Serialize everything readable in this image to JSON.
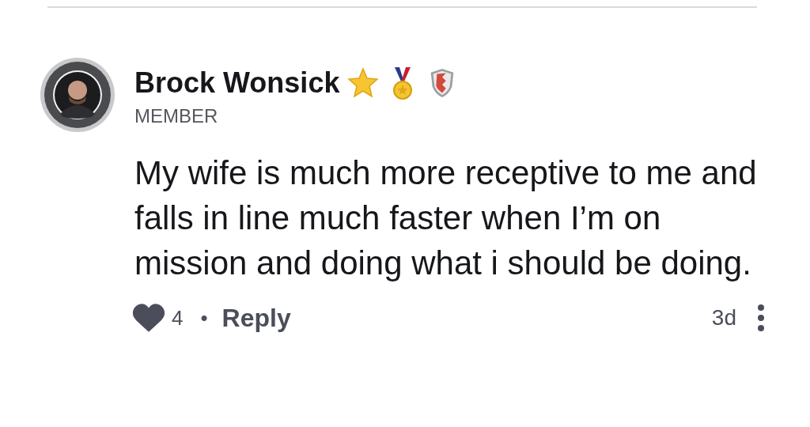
{
  "comment": {
    "author": "Brock Wonsick",
    "badges": [
      {
        "kind": "star"
      },
      {
        "kind": "medal"
      },
      {
        "kind": "shield"
      }
    ],
    "role": "MEMBER",
    "body": "My wife is much more receptive to me and falls in line much faster when I’m on mission and doing what i should be doing.",
    "likes": "4",
    "separator": "•",
    "reply": "Reply",
    "age": "3d"
  }
}
